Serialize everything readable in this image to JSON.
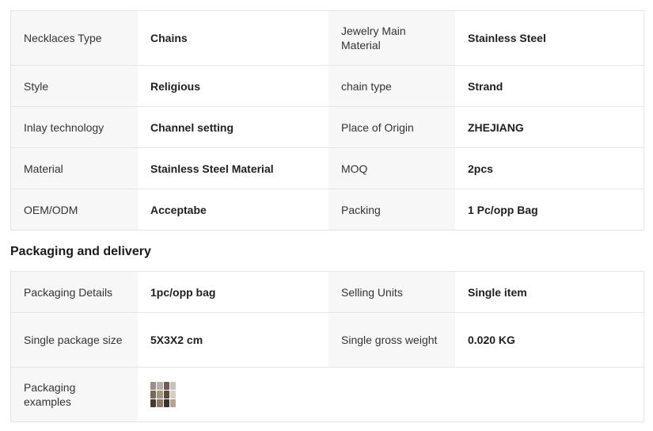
{
  "specs": {
    "rows": [
      {
        "k1": "Necklaces Type",
        "v1": "Chains",
        "k2": "Jewelry Main Material",
        "v2": "Stainless Steel"
      },
      {
        "k1": "Style",
        "v1": "Religious",
        "k2": "chain type",
        "v2": "Strand"
      },
      {
        "k1": "Inlay technology",
        "v1": "Channel setting",
        "k2": "Place of Origin",
        "v2": "ZHEJIANG"
      },
      {
        "k1": "Material",
        "v1": "Stainless Steel Material",
        "k2": "MOQ",
        "v2": "2pcs"
      },
      {
        "k1": "OEM/ODM",
        "v1": "Acceptabe",
        "k2": "Packing",
        "v2": "1 Pc/opp Bag"
      }
    ]
  },
  "packaging": {
    "title": "Packaging and delivery",
    "rows": [
      {
        "k1": "Packaging Details",
        "v1": "1pc/opp bag",
        "k2": "Selling Units",
        "v2": "Single item"
      },
      {
        "k1": "Single package size",
        "v1": "5X3X2 cm",
        "k2": "Single gross weight",
        "v2": "0.020 KG"
      }
    ],
    "examples_label": "Packaging examples",
    "examples_thumb_colors": [
      "#9a8f86",
      "#b8b0a8",
      "#6e5f55",
      "#c9c2bb",
      "#7b6a5c",
      "#a8957f",
      "#5c4a3d",
      "#d6cfc7",
      "#4a3b30",
      "#8c7a6a",
      "#3e3128",
      "#b3a593"
    ]
  }
}
